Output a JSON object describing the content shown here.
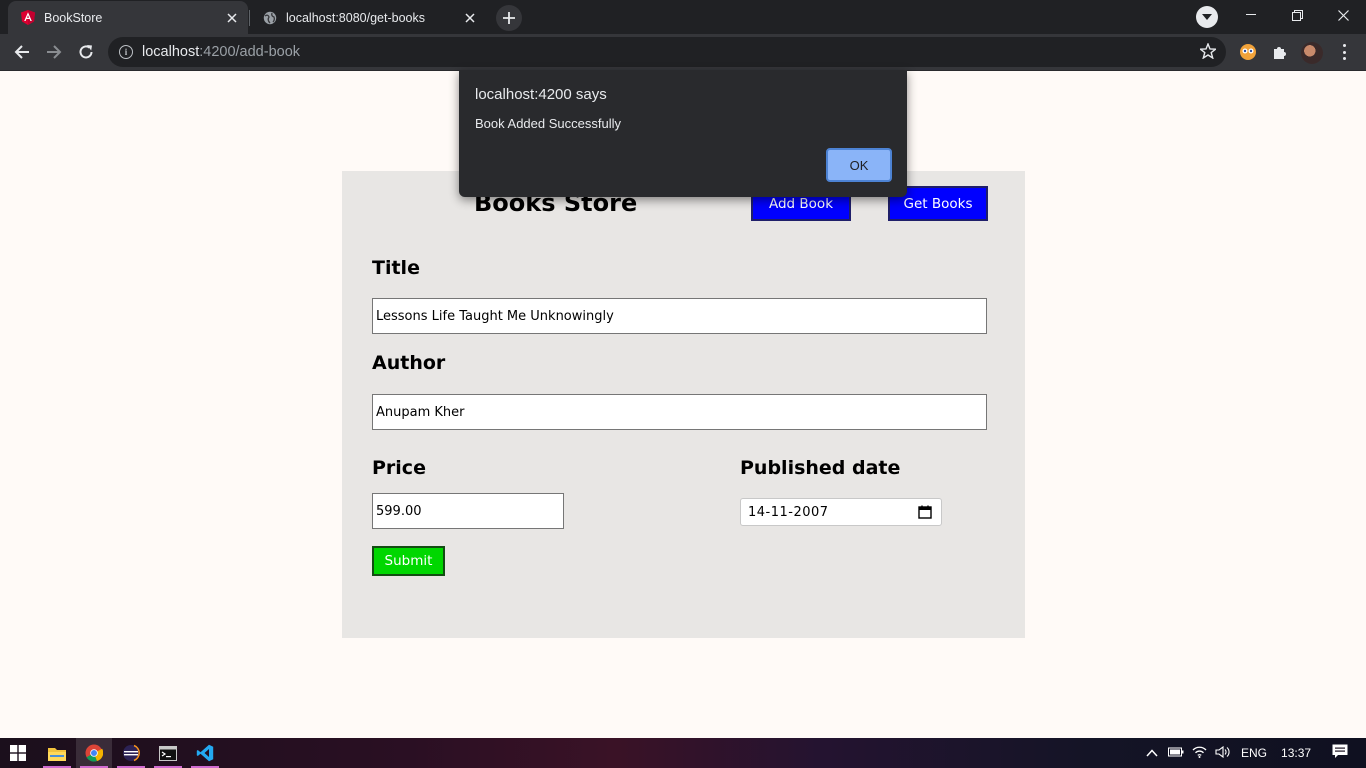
{
  "browser": {
    "tabs": [
      {
        "title": "BookStore",
        "active": true
      },
      {
        "title": "localhost:8080/get-books",
        "active": false
      }
    ],
    "url_host": "localhost",
    "url_rest": ":4200/add-book"
  },
  "page": {
    "store_title": "Books Store",
    "nav": {
      "add_book": "Add Book",
      "get_books": "Get Books"
    },
    "form": {
      "title_label": "Title",
      "title_value": "Lessons Life Taught Me Unknowingly",
      "author_label": "Author",
      "author_value": "Anupam Kher",
      "price_label": "Price",
      "price_value": "599.00",
      "date_label": "Published date",
      "date_value": "14-11-2007",
      "submit_label": "Submit"
    }
  },
  "alert": {
    "title": "localhost:4200 says",
    "message": "Book Added Successfully",
    "ok_label": "OK"
  },
  "taskbar": {
    "language": "ENG",
    "time": "13:37"
  },
  "colors": {
    "nav_button": "#0000ff",
    "submit_button": "#00d700",
    "alert_ok": "#8ab4f8",
    "card_bg": "#e8e6e4"
  }
}
